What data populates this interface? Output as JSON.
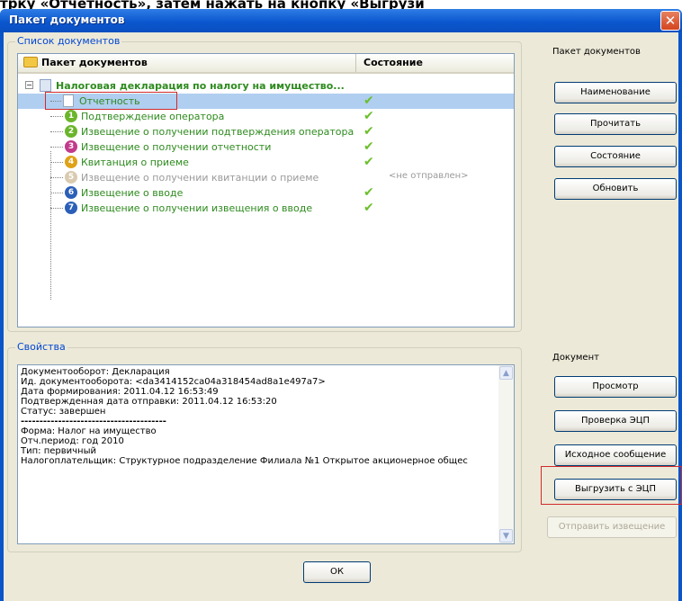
{
  "instruction_text": "трку «Отчетность», затем нажать на кнопку «Выгрузи",
  "window": {
    "title": "Пакет документов",
    "close_glyph": "✕"
  },
  "doc_list": {
    "group_label": "Список документов",
    "col_document": "Пакет документов",
    "col_state": "Состояние",
    "rows": [
      {
        "label": "Налоговая декларация по налогу на имущество...",
        "kind": "root",
        "state": ""
      },
      {
        "label": "Отчетность",
        "kind": "file",
        "state": "✔",
        "selected": true
      },
      {
        "number": "1",
        "label": "Подтверждение оператора",
        "color": "#6bb52b",
        "state": "✔"
      },
      {
        "number": "2",
        "label": "Извещение о получении подтверждения оператора",
        "color": "#6bb52b",
        "state": "✔"
      },
      {
        "number": "3",
        "label": "Извещение о получении отчетности",
        "color": "#c23a8a",
        "state": "✔"
      },
      {
        "number": "4",
        "label": "Квитанция о приеме",
        "color": "#e0a216",
        "state": "✔"
      },
      {
        "number": "5",
        "label": "Извещение о получении квитанции о приеме",
        "color": "#d9cbb0",
        "state": "<не отправлен>",
        "muted": true
      },
      {
        "number": "6",
        "label": "Извещение о вводе",
        "color": "#2b5fb8",
        "state": "✔"
      },
      {
        "number": "7",
        "label": "Извещение о получении извещения о вводе",
        "color": "#2b5fb8",
        "state": "✔"
      }
    ]
  },
  "props": {
    "group_label": "Свойства",
    "lines": [
      "Документооборот: Декларация",
      "Ид. документооборота: <da3414152ca04a318454ad8a1e497a7>",
      "Дата формирования: 2011.04.12 16:53:49",
      "Подтвержденная дата отправки: 2011.04.12 16:53:20",
      "Статус: завершен",
      "---------------------------------------",
      "Форма: Налог на имущество",
      "Отч.период: год 2010",
      "Тип: первичный",
      "Налогоплательщик: Структурное подразделение Филиала №1 Открытое акционерное общес"
    ]
  },
  "side_package": {
    "label": "Пакет документов",
    "buttons": [
      "Наименование",
      "Прочитать",
      "Состояние",
      "Обновить"
    ]
  },
  "side_document": {
    "label": "Документ",
    "buttons": [
      "Просмотр",
      "Проверка ЭЦП",
      "Исходное сообщение",
      "Выгрузить с ЭЦП"
    ],
    "disabled_button": "Отправить извещение"
  },
  "ok_label": "ОК",
  "colors": {
    "title_blue": "#0b57cf",
    "tree_green_text": "#2e8b1e",
    "selection": "#b0cef0",
    "highlight_red": "#d22a2a"
  }
}
